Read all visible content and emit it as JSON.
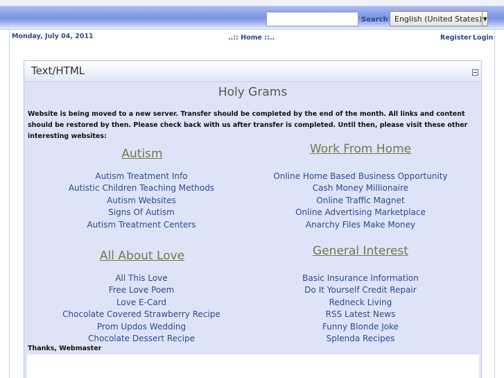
{
  "header": {
    "search_placeholder": "",
    "search_button": "Search",
    "language": "English (United States)",
    "language_arrow": "▼"
  },
  "infobar": {
    "date": "Monday, July 04, 2011",
    "breadcrumb_prefix": "..::",
    "breadcrumb_home": "Home",
    "breadcrumb_suffix": "::..",
    "register": "Register",
    "login": "Login"
  },
  "module": {
    "title": "Text/HTML",
    "site_title": "Holy Grams",
    "intro": "Website is being moved to a new server. Transfer should be completed by the end of the month. All links and content should be restored by then. Please check back with us after transfer is completed. Until then, please visit these other interesting websites:",
    "sections": [
      {
        "heading": "Autism",
        "links": [
          "Autism Treatment Info",
          "Autistic Children Teaching Methods",
          "Autism Websites",
          "Signs Of Autism",
          "Autism Treatment Centers"
        ]
      },
      {
        "heading": "Work From Home",
        "links": [
          "Online Home Based Business Opportunity",
          "Cash Money Millionaire",
          "Online Traffic Magnet",
          "Online Advertising Marketplace",
          "Anarchy Files Make Money"
        ]
      },
      {
        "heading": "All About Love",
        "links": [
          "All This Love",
          "Free Love Poem",
          "Love E-Card",
          "Chocolate Covered Strawberry Recipe",
          "Prom Updos Wedding",
          "Chocolate Dessert Recipe"
        ]
      },
      {
        "heading": "General Interest",
        "links": [
          "Basic Insurance Information",
          "Do It Yourself Credit Repair",
          "Redneck Living",
          "RSS Latest News",
          "Funny Blonde Joke",
          "Splenda Recipes"
        ]
      }
    ],
    "thanks": "Thanks, Webmaster"
  },
  "colors": {
    "link": "#2d4a8a",
    "heading": "#6b7c48",
    "module_bg": "#dde4f8"
  }
}
